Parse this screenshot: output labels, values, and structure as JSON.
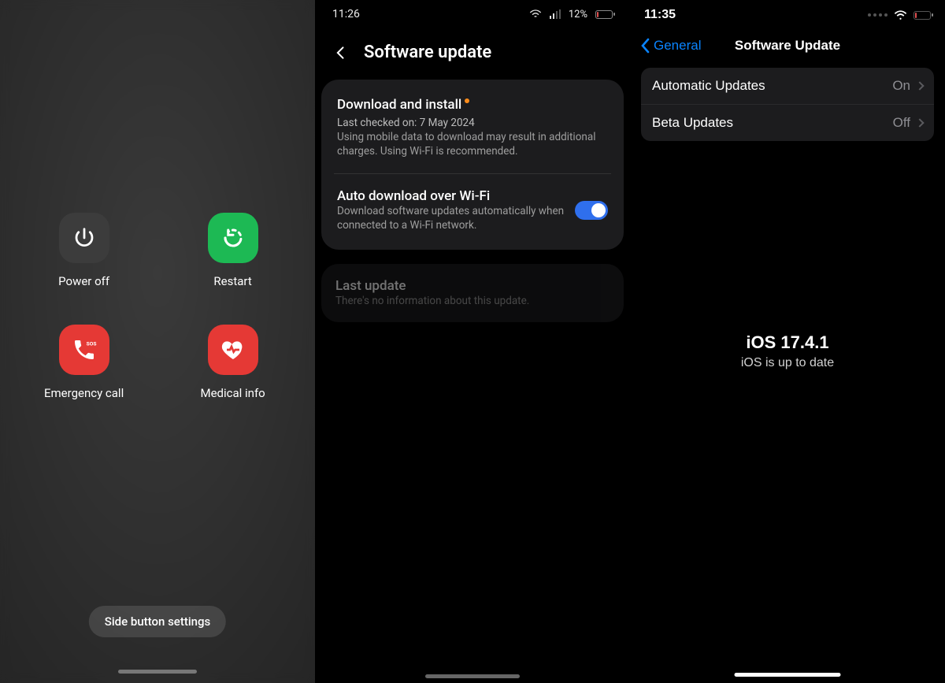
{
  "panel1": {
    "power_off": "Power off",
    "restart": "Restart",
    "emergency_call": "Emergency call",
    "medical_info": "Medical info",
    "side_button_settings": "Side button settings"
  },
  "panel2": {
    "status": {
      "time": "11:26",
      "battery_text": "12%"
    },
    "title": "Software update",
    "download": {
      "title": "Download and install",
      "last_checked": "Last checked on: 7 May 2024",
      "note": "Using mobile data to download may result in additional charges. Using Wi-Fi is recommended."
    },
    "auto": {
      "title": "Auto download over Wi-Fi",
      "sub": "Download software updates automatically when connected to a Wi-Fi network."
    },
    "last": {
      "title": "Last update",
      "sub": "There's no information about this update."
    }
  },
  "panel3": {
    "status": {
      "time": "11:35"
    },
    "back_label": "General",
    "title": "Software Update",
    "rows": {
      "auto": {
        "label": "Automatic Updates",
        "value": "On"
      },
      "beta": {
        "label": "Beta Updates",
        "value": "Off"
      }
    },
    "version": "iOS 17.4.1",
    "uptodate": "iOS is up to date"
  }
}
